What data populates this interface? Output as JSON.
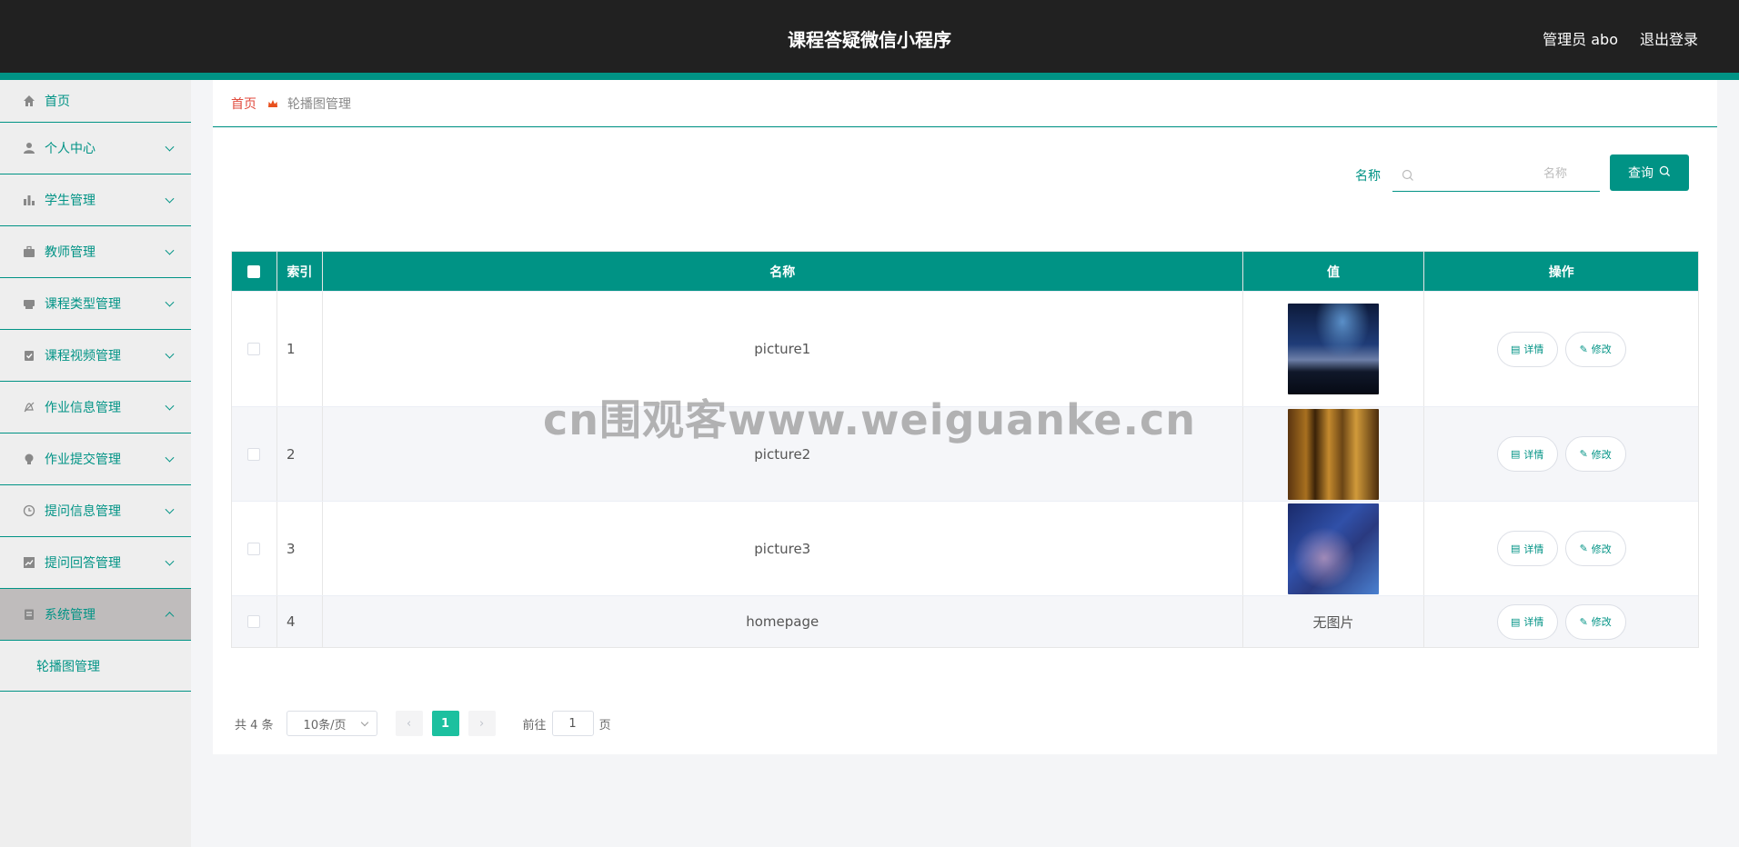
{
  "header": {
    "title": "课程答疑微信小程序",
    "user_label": "管理员 abo",
    "logout_label": "退出登录"
  },
  "colors": {
    "accent": "#009385",
    "header_bg": "#212121",
    "active_page": "#1cc09f"
  },
  "sidebar": {
    "items": [
      {
        "label": "首页",
        "icon": "home-icon"
      },
      {
        "label": "个人中心",
        "icon": "user-icon"
      },
      {
        "label": "学生管理",
        "icon": "bar-chart-icon"
      },
      {
        "label": "教师管理",
        "icon": "briefcase-icon"
      },
      {
        "label": "课程类型管理",
        "icon": "printer-icon"
      },
      {
        "label": "课程视频管理",
        "icon": "clipboard-check-icon"
      },
      {
        "label": "作业信息管理",
        "icon": "bell-off-icon"
      },
      {
        "label": "作业提交管理",
        "icon": "bulb-icon"
      },
      {
        "label": "提问信息管理",
        "icon": "clock-icon"
      },
      {
        "label": "提问回答管理",
        "icon": "trend-chart-icon"
      },
      {
        "label": "系统管理",
        "icon": "document-icon"
      }
    ],
    "sub_item": "轮播图管理"
  },
  "breadcrumb": {
    "home": "首页",
    "current": "轮播图管理"
  },
  "search": {
    "label": "名称",
    "placeholder": "名称",
    "value": "",
    "button": "查询"
  },
  "table": {
    "headers": {
      "index": "索引",
      "name": "名称",
      "value": "值",
      "ops": "操作"
    },
    "rows": [
      {
        "index": "1",
        "name": "picture1",
        "value": "",
        "image": "night-sky-comet"
      },
      {
        "index": "2",
        "name": "picture2",
        "value": "",
        "image": "blurred-golden-street"
      },
      {
        "index": "3",
        "name": "picture3",
        "value": "",
        "image": "blurred-blue-city"
      },
      {
        "index": "4",
        "name": "homepage",
        "value": "无图片",
        "image": ""
      }
    ],
    "detail_label": "详情",
    "edit_label": "修改"
  },
  "pagination": {
    "total": "共 4 条",
    "page_size": "10条/页",
    "current_page": "1",
    "goto_prefix": "前往",
    "goto_value": "1",
    "goto_suffix": "页"
  },
  "watermark": "cn围观客www.weiguanke.cn"
}
